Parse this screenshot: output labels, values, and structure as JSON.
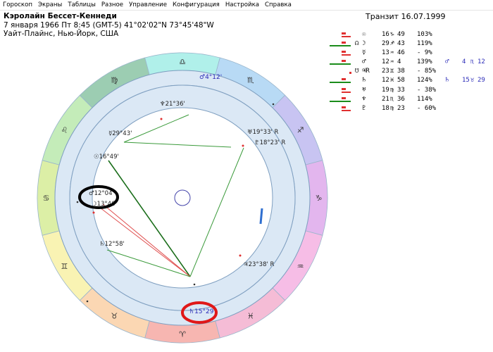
{
  "menu": [
    "Гороскоп",
    "Экраны",
    "Таблицы",
    "Разное",
    "Управление",
    "Конфигурация",
    "Настройка",
    "Справка"
  ],
  "header": {
    "name": "Кэролайн Бессет-Кеннеди",
    "line2": "7 января 1966  Пт   8:45 (GMT-5) 41°02'02\"N  73°45'48\"W",
    "line3": "Уайт-Плайнс, Нью-Йорк, США"
  },
  "transit_title": "Транзит 16.07.1999",
  "planets": [
    {
      "glyph": "☉",
      "retro": "",
      "deg": "16",
      "sign": "♑",
      "min": "49",
      "pct": "103%",
      "bar": "red"
    },
    {
      "glyph": "☽",
      "retro": "",
      "deg": "29",
      "sign": "♐",
      "min": "43",
      "pct": "119%",
      "bar": "green",
      "left_glyph": "☊"
    },
    {
      "glyph": "☿",
      "retro": "",
      "deg": "13",
      "sign": "♒",
      "min": "46",
      "pct": "- 9%",
      "bar": "red"
    },
    {
      "glyph": "♂",
      "retro": "",
      "deg": "12",
      "sign": "♒",
      "min": " 4",
      "pct": "139%",
      "bar": "green",
      "transit_glyph": "♂",
      "transit_deg": "4",
      "transit_sign": "♏",
      "transit_min": "12"
    },
    {
      "glyph": "♃",
      "retro": "R",
      "deg": "23",
      "sign": "♊",
      "min": "38",
      "pct": "- 85%",
      "bar": "dot",
      "left_glyph": "☋"
    },
    {
      "glyph": "♄",
      "retro": "",
      "deg": "12",
      "sign": "♓",
      "min": "58",
      "pct": "124%",
      "bar": "green",
      "transit_glyph": "♄",
      "transit_deg": "15",
      "transit_sign": "♉",
      "transit_min": "29"
    },
    {
      "glyph": "♅",
      "retro": "",
      "deg": "19",
      "sign": "♍",
      "min": "33",
      "pct": "- 38%",
      "bar": "red"
    },
    {
      "glyph": "♆",
      "retro": "",
      "deg": "21",
      "sign": "♏",
      "min": "36",
      "pct": "114%",
      "bar": "green"
    },
    {
      "glyph": "♇",
      "retro": "",
      "deg": "18",
      "sign": "♍",
      "min": "23",
      "pct": "- 60%",
      "bar": "red"
    }
  ],
  "wheel": {
    "signs": [
      {
        "glyph": "♈",
        "color": "#f7b6b1"
      },
      {
        "glyph": "♉",
        "color": "#fbd7b3"
      },
      {
        "glyph": "♊",
        "color": "#f9f3b3"
      },
      {
        "glyph": "♋",
        "color": "#dcefa6"
      },
      {
        "glyph": "♌",
        "color": "#c4ecb9"
      },
      {
        "glyph": "♍",
        "color": "#9ccdb2"
      },
      {
        "glyph": "♎",
        "color": "#b0f0ea"
      },
      {
        "glyph": "♏",
        "color": "#b8daf5"
      },
      {
        "glyph": "♐",
        "color": "#c8c4f2"
      },
      {
        "glyph": "♑",
        "color": "#e3b6ee"
      },
      {
        "glyph": "♒",
        "color": "#f6bde6"
      },
      {
        "glyph": "♓",
        "color": "#f5bcd6"
      }
    ],
    "transit_labels": [
      {
        "glyph": "♂",
        "text": "4°12'",
        "color": "#2a2ab8",
        "name": "transit-mars-label"
      },
      {
        "glyph": "♄",
        "text": "15°29'",
        "color": "#2a2ab8",
        "name": "transit-saturn-label"
      }
    ],
    "natal_labels": [
      {
        "glyph": "♆",
        "text": "21°36'",
        "name": "natal-neptune-label"
      },
      {
        "glyph": "☿",
        "text": "29°43'",
        "name": "natal-mercury-label"
      },
      {
        "glyph": "☉",
        "text": "16°49'",
        "name": "natal-sun-label"
      },
      {
        "glyph": "♂",
        "text": "12°04'",
        "name": "natal-mars-label"
      },
      {
        "glyph": "♄",
        "text": "12°58'",
        "name": "natal-saturn-label"
      },
      {
        "glyph": "♅",
        "text": "19°33'",
        "retro": "R",
        "name": "natal-uranus-label"
      },
      {
        "glyph": "♇",
        "text": "18°23'",
        "retro": "R",
        "name": "natal-pluto-label"
      },
      {
        "glyph": "♃",
        "text": "23°38'",
        "retro": "R",
        "name": "natal-jupiter-label"
      },
      {
        "glyph": "☽",
        "text": "13°46'",
        "name": "natal-moon-label"
      }
    ],
    "highlight_colors": {
      "black_oval": "#000000",
      "red_oval": "#e01818"
    }
  }
}
